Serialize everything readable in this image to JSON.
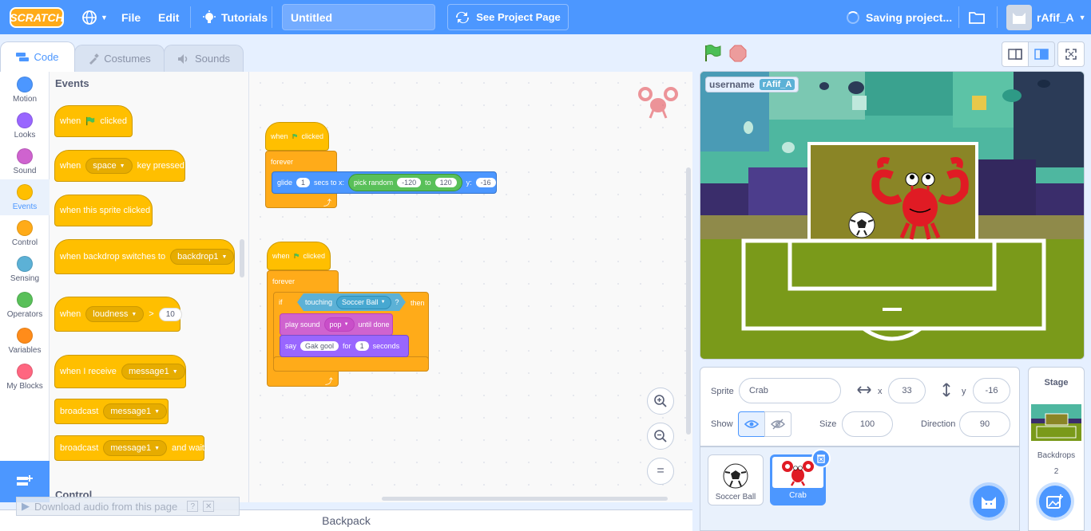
{
  "menu": {
    "logo": "SCRATCH",
    "file": "File",
    "edit": "Edit",
    "tutorials": "Tutorials",
    "project_title": "Untitled",
    "see_project_page": "See Project Page",
    "saving": "Saving project...",
    "username": "rAfif_A"
  },
  "tabs": {
    "code": "Code",
    "costumes": "Costumes",
    "sounds": "Sounds"
  },
  "categories": [
    {
      "label": "Motion",
      "color": "#4c97ff"
    },
    {
      "label": "Looks",
      "color": "#9966ff"
    },
    {
      "label": "Sound",
      "color": "#cf63cf"
    },
    {
      "label": "Events",
      "color": "#ffbf00"
    },
    {
      "label": "Control",
      "color": "#ffab19"
    },
    {
      "label": "Sensing",
      "color": "#5cb1d6"
    },
    {
      "label": "Operators",
      "color": "#59c059"
    },
    {
      "label": "Variables",
      "color": "#ff8c1a"
    },
    {
      "label": "My Blocks",
      "color": "#ff6680"
    }
  ],
  "palette": {
    "heading": "Events",
    "next_heading": "Control",
    "when": "when",
    "clicked": "clicked",
    "key_value": "space",
    "key_pressed": "key pressed",
    "sprite_clicked": "when this sprite clicked",
    "backdrop_switches": "when backdrop switches to",
    "backdrop_value": "backdrop1",
    "loudness": "loudness",
    "gt": ">",
    "loudness_value": "10",
    "receive": "when I receive",
    "message": "message1",
    "broadcast": "broadcast",
    "and_wait": "and wait"
  },
  "script1": {
    "when": "when",
    "clicked": "clicked",
    "forever": "forever",
    "glide": "glide",
    "glide_secs": "1",
    "secs_to_x": "secs to x:",
    "pick_random": "pick random",
    "rand_from": "-120",
    "to": "to",
    "rand_to": "120",
    "y": "y:",
    "y_value": "-16"
  },
  "script2": {
    "when": "when",
    "clicked": "clicked",
    "forever": "forever",
    "if": "if",
    "touching": "touching",
    "touch_target": "Soccer Ball",
    "q": "?",
    "then": "then",
    "play_sound": "play sound",
    "sound_name": "pop",
    "until_done": "until done",
    "say": "say",
    "say_text": "Gak gool",
    "for": "for",
    "say_secs": "1",
    "seconds": "seconds"
  },
  "workspace": {
    "zoom_reset": "="
  },
  "backpack": "Backpack",
  "download_bar": "Download audio from this page",
  "stage": {
    "var_name": "username",
    "var_value": "rAfif_A"
  },
  "sprite_info": {
    "sprite_label": "Sprite",
    "sprite_name": "Crab",
    "x_label": "x",
    "x_value": "33",
    "y_label": "y",
    "y_value": "-16",
    "show_label": "Show",
    "size_label": "Size",
    "size_value": "100",
    "direction_label": "Direction",
    "direction_value": "90"
  },
  "sprites": [
    {
      "name": "Soccer Ball",
      "selected": false
    },
    {
      "name": "Crab",
      "selected": true
    }
  ],
  "stage_panel": {
    "title": "Stage",
    "backdrops_label": "Backdrops",
    "backdrops_count": "2"
  },
  "colors": {
    "accent": "#4c97ff",
    "events": "#ffbf00",
    "control": "#ffab19"
  }
}
